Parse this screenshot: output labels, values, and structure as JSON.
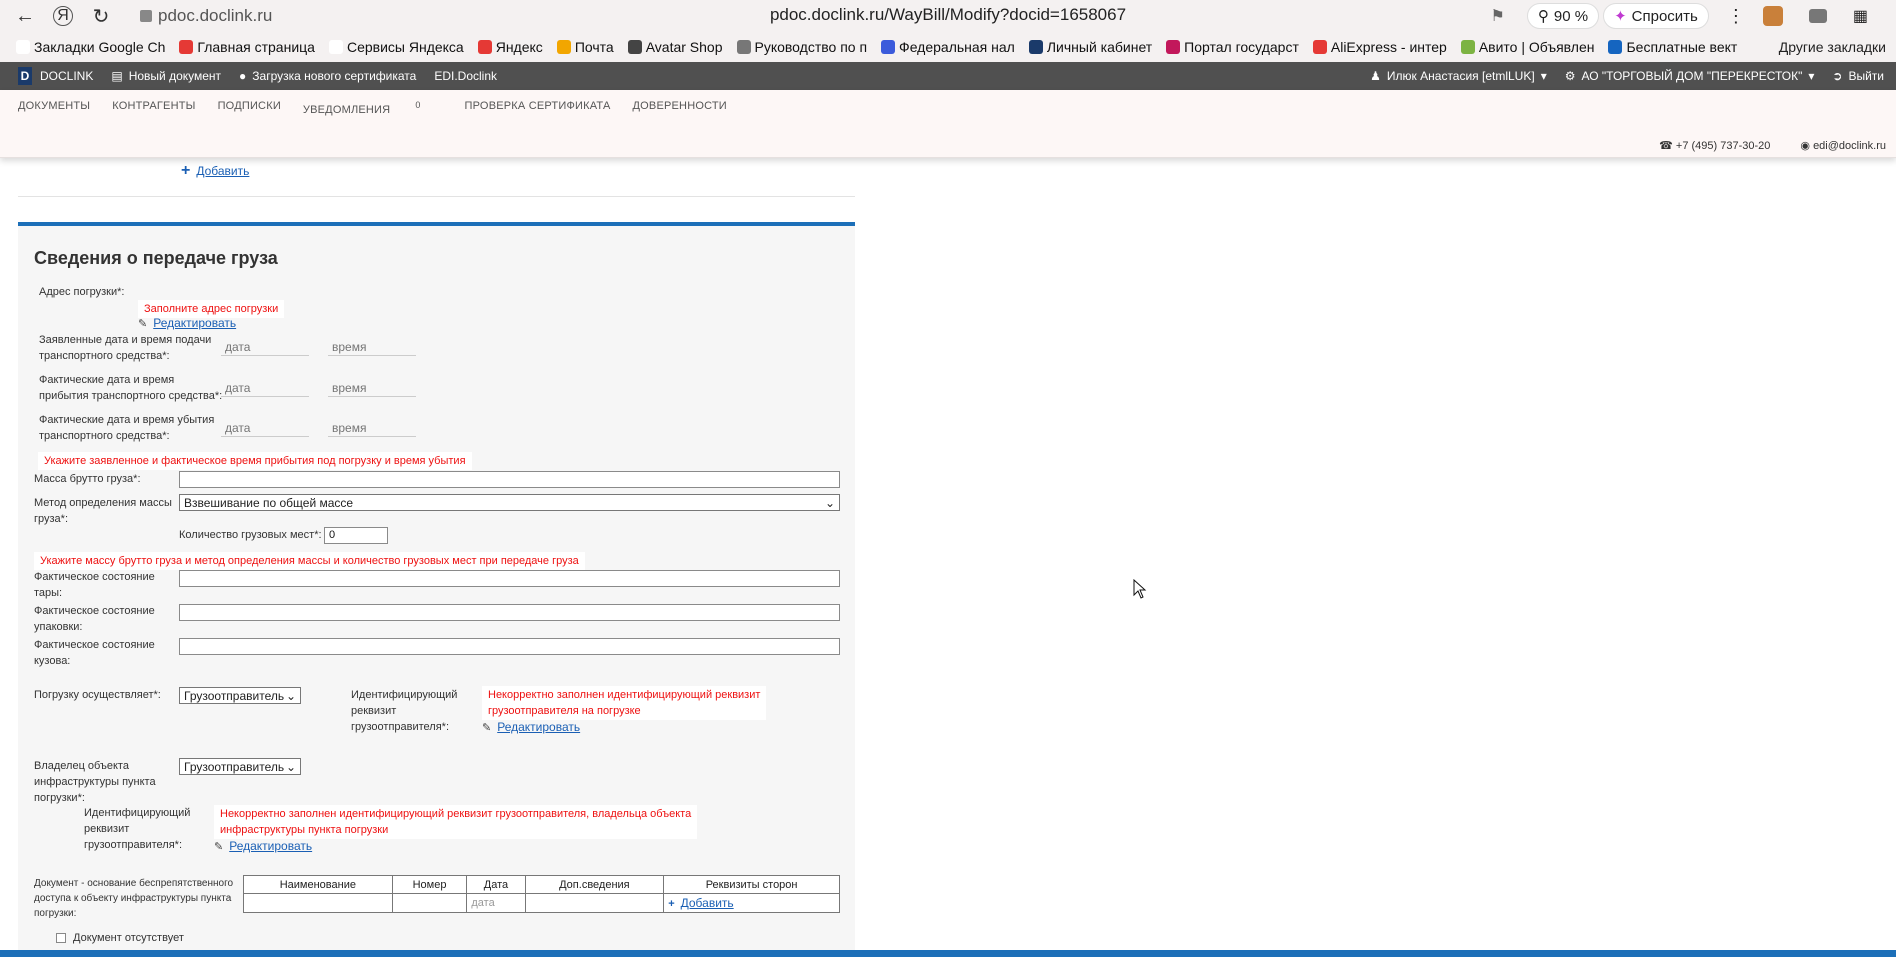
{
  "browser": {
    "url_host": "pdoc.doclink.ru",
    "url_full": "pdoc.doclink.ru/WayBill/Modify?docid=1658067",
    "zoom": "90 %",
    "ask_label": "Спросить",
    "bookmarks": [
      {
        "label": "Закладки Google Ch",
        "color": "#ffffff"
      },
      {
        "label": "Главная страница",
        "color": "#e53935"
      },
      {
        "label": "Сервисы Яндекса",
        "color": "#ffffff"
      },
      {
        "label": "Яндекс",
        "color": "#e53935"
      },
      {
        "label": "Почта",
        "color": "#f2a600"
      },
      {
        "label": "Avatar Shop",
        "color": "#444444"
      },
      {
        "label": "Руководство по п",
        "color": "#777777"
      },
      {
        "label": "Федеральная нал",
        "color": "#3b5bdb"
      },
      {
        "label": "Личный кабинет",
        "color": "#1a3a6a"
      },
      {
        "label": "Портал государст",
        "color": "#c2185b"
      },
      {
        "label": "AliExpress - интер",
        "color": "#e53935"
      },
      {
        "label": "Авито | Объявлен",
        "color": "#7cb342"
      },
      {
        "label": "Бесплатные вект",
        "color": "#1565c0"
      }
    ],
    "other_bookmarks": "Другие закладки"
  },
  "app": {
    "logo_letter": "D",
    "brand": "DOCLINK",
    "new_doc": "Новый документ",
    "upload_cert": "Загрузка нового сертификата",
    "edi": "EDI.Doclink",
    "user": "Илюк Анастасия [etmlLUK]",
    "org": "АО \"ТОРГОВЫЙ ДОМ \"ПЕРЕКРЕСТОК\"",
    "logout": "Выйти",
    "menu": {
      "documents": "ДОКУМЕНТЫ",
      "contractors": "КОНТРАГЕНТЫ",
      "signatures": "ПОДПИСКИ",
      "notifications": "УВЕДОМЛЕНИЯ",
      "notifications_count": "0",
      "cert_check": "ПРОВЕРКА СЕРТИФИКАТА",
      "powers": "ДОВЕРЕННОСТИ"
    },
    "phone": "+7 (495) 737-30-20",
    "email": "edi@doclink.ru"
  },
  "form": {
    "add_top": "Добавить",
    "section_title": "Сведения о передаче груза",
    "load_address_label": "Адрес погрузки*:",
    "load_address_error": "Заполните адрес погрузки",
    "edit": "Редактировать",
    "declared_dt_label_1": "Заявленные дата и время подачи",
    "declared_dt_label_2": "транспортного средства*:",
    "arrival_dt_label_1": "Фактические дата и время",
    "arrival_dt_label_2": "прибытия транспортного средства*:",
    "depart_dt_label_1": "Фактические дата и время убытия",
    "depart_dt_label_2": "транспортного средства*:",
    "date_placeholder": "дата",
    "time_placeholder": "время",
    "time_error": "Укажите заявленное и фактическое время прибытия под погрузку и время убытия",
    "gross_mass_label": "Масса брутто груза*:",
    "mass_method_label_1": "Метод определения массы",
    "mass_method_label_2": "груза*:",
    "mass_method_value": "Взвешивание по общей массе",
    "places_label": "Количество грузовых мест*:",
    "places_value": "0",
    "mass_error": "Укажите массу брутто груза и метод определения массы и количество грузовых мест при передаче груза",
    "tare_label_1": "Фактическое состояние",
    "tare_label_2": "тары:",
    "pack_label_1": "Фактическое состояние",
    "pack_label_2": "упаковки:",
    "body_label_1": "Фактическое состояние",
    "body_label_2": "кузова:",
    "loader_label": "Погрузку осуществляет*:",
    "shipper_option": "Грузоотправитель",
    "id_req_label_1": "Идентифицирующий",
    "id_req_label_2": "реквизит",
    "id_req_label_3": "грузоотправителя*:",
    "id_req_error_1": "Некорректно заполнен идентифицирующий реквизит",
    "id_req_error_2": "грузоотправителя на погрузке",
    "owner_label_1": "Владелец объекта",
    "owner_label_2": "инфраструктуры пункта",
    "owner_label_3": "погрузки*:",
    "owner_error_1": "Некорректно заполнен идентифицирующий реквизит грузоотправителя, владельца объекта",
    "owner_error_2": "инфраструктуры пункта погрузки",
    "doc_basis_label_1": "Документ - основание беспрепятственного",
    "doc_basis_label_2": "доступа к объекту инфраструктуры пункта",
    "doc_basis_label_3": "погрузки:",
    "table_headers": [
      "Наименование",
      "Номер",
      "Дата",
      "Доп.сведения",
      "Реквизиты сторон"
    ],
    "table_date_placeholder": "дата",
    "table_add": "Добавить",
    "doc_absent": "Документ отсутствует"
  }
}
